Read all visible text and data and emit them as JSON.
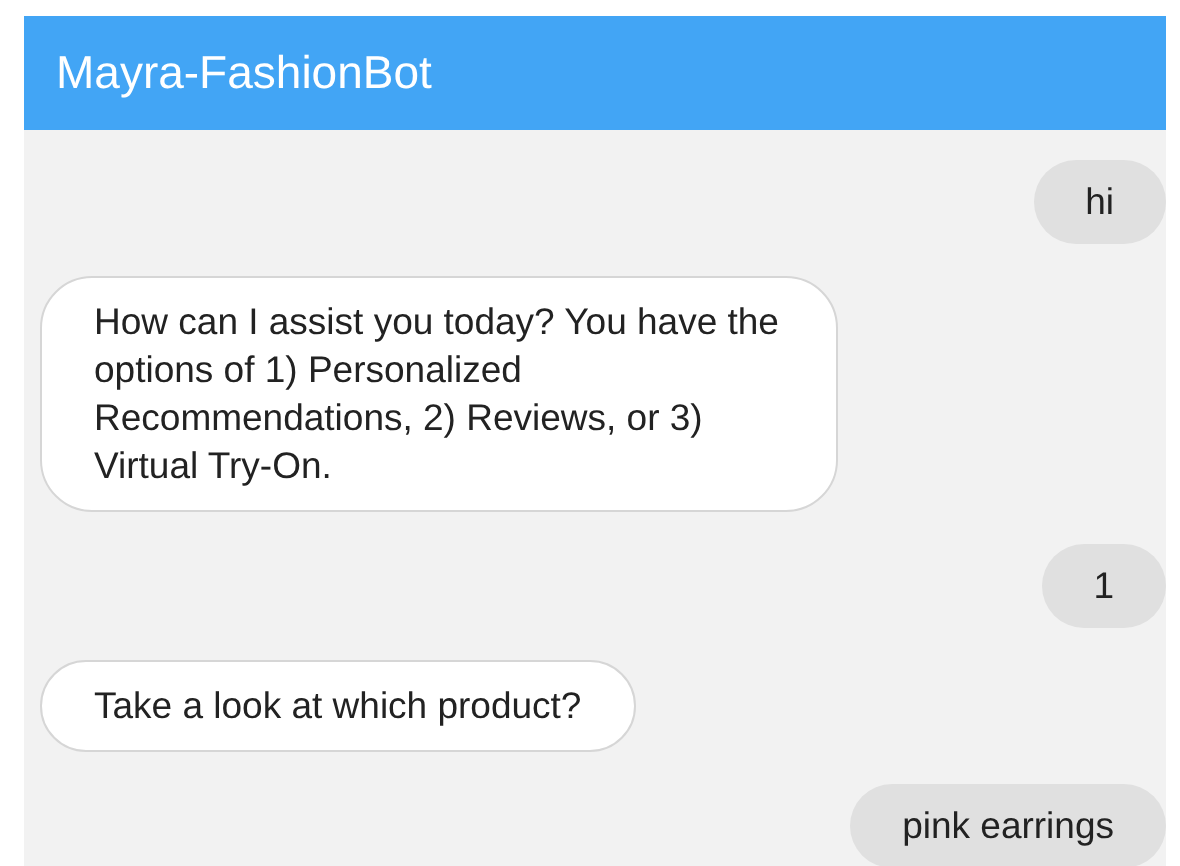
{
  "window": {
    "title": "Mayra-FashionBot"
  },
  "messages": [
    {
      "kind": "user",
      "text": "hi"
    },
    {
      "kind": "bot",
      "text": "How can I assist you today? You have the options of 1) Personalized Recommendations, 2) Reviews, or 3) Virtual Try-On."
    },
    {
      "kind": "user",
      "text": "1"
    },
    {
      "kind": "bot",
      "text": "Take a look at which product?"
    },
    {
      "kind": "user",
      "text": "pink earrings"
    }
  ]
}
